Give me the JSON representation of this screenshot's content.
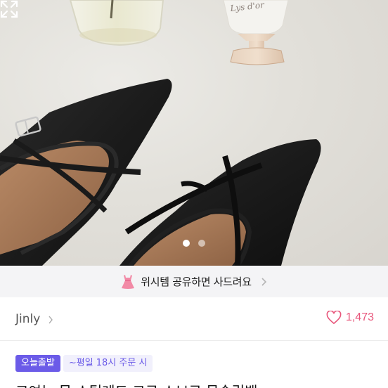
{
  "product_image": {
    "bottle_label": "Lys d'or",
    "carousel_pages": 2,
    "carousel_current": 1
  },
  "icons": {
    "expand": "expand-arrows-icon",
    "promo": "pink-dress-icon",
    "heart": "heart-outline-icon",
    "chevron": "chevron-right-icon"
  },
  "promo": {
    "text": "위시템 공유하면 사드려요"
  },
  "seller": {
    "name": "Jinly"
  },
  "likes": {
    "count": "1,473"
  },
  "tags": {
    "badge": "오늘출발",
    "note": "~평일 18시 주문 시"
  },
  "product": {
    "title": "고여는 뮬 스틸레토 코로 스브로 뮬슬립백"
  },
  "colors": {
    "accent": "#6b5be8",
    "like": "#e8577c",
    "banner_bg": "#f4f4f6"
  }
}
